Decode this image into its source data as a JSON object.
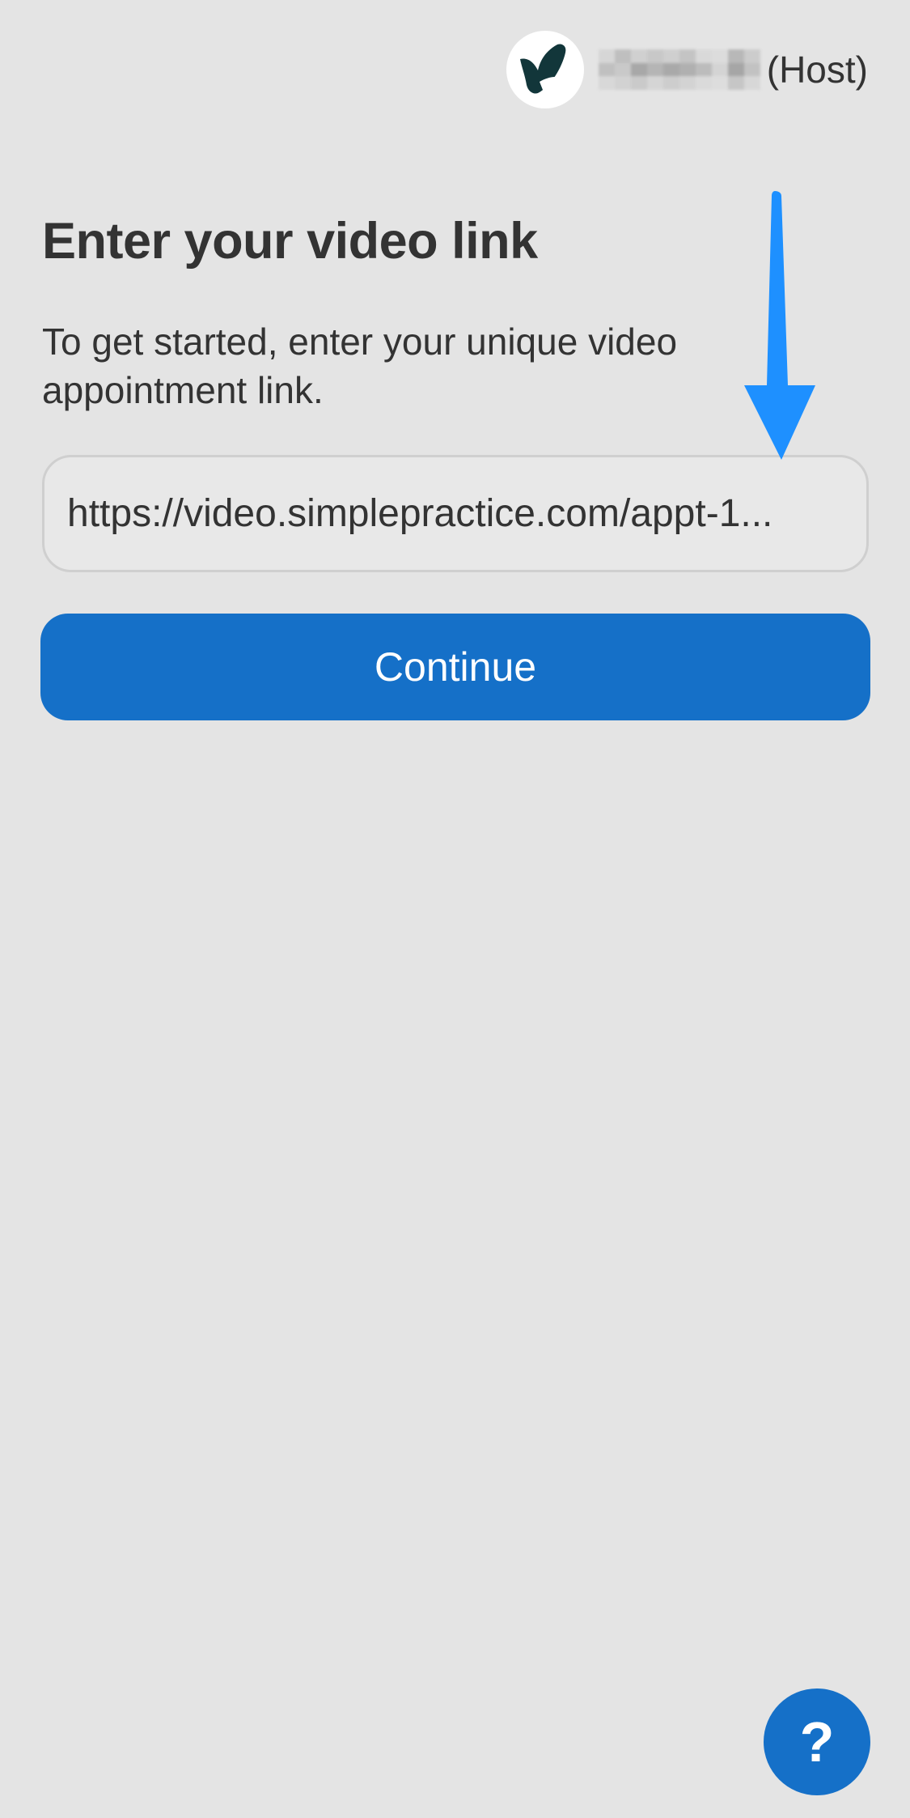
{
  "header": {
    "logo_icon": "simplepractice-logo-icon",
    "host_suffix": "(Host)",
    "name_redacted": true
  },
  "main": {
    "title": "Enter your video link",
    "description": "To get started, enter your unique video appointment link.",
    "link_input": {
      "value": "https://video.simplepractice.com/appt-1...",
      "placeholder": ""
    },
    "continue_label": "Continue"
  },
  "annotation": {
    "arrow_icon": "down-arrow-icon",
    "color": "#1e90ff"
  },
  "help": {
    "label": "?",
    "icon": "help-icon"
  },
  "colors": {
    "background": "#e4e4e4",
    "primary": "#1570c8",
    "text": "#333333",
    "logo_dark": "#12363a"
  }
}
